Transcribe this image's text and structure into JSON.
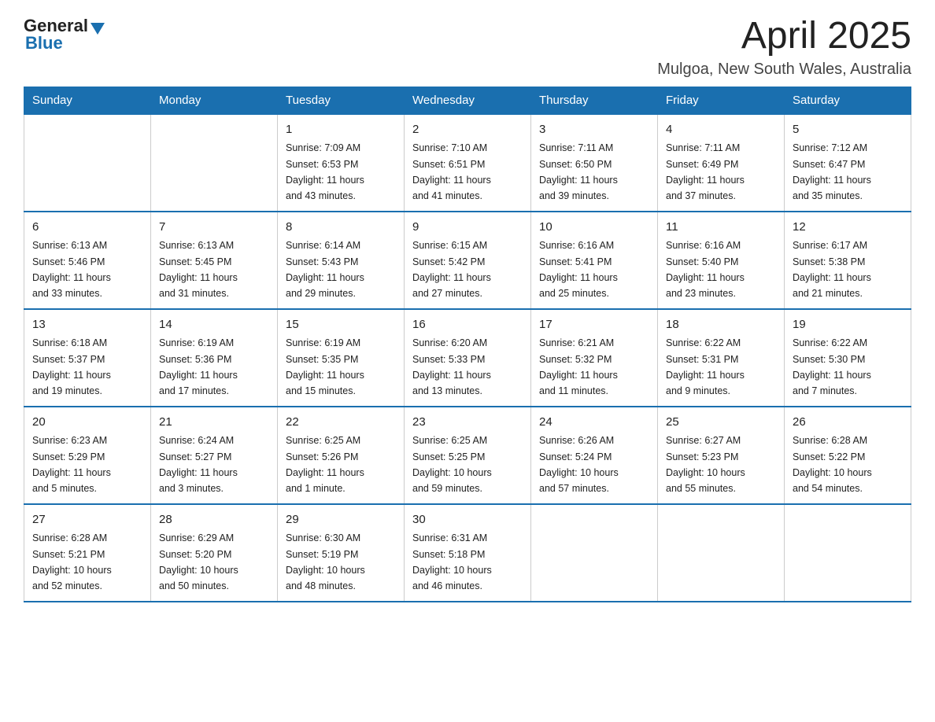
{
  "header": {
    "logo_general": "General",
    "logo_blue": "Blue",
    "month_title": "April 2025",
    "location": "Mulgoa, New South Wales, Australia"
  },
  "weekdays": [
    "Sunday",
    "Monday",
    "Tuesday",
    "Wednesday",
    "Thursday",
    "Friday",
    "Saturday"
  ],
  "weeks": [
    [
      {
        "day": "",
        "info": ""
      },
      {
        "day": "",
        "info": ""
      },
      {
        "day": "1",
        "info": "Sunrise: 7:09 AM\nSunset: 6:53 PM\nDaylight: 11 hours\nand 43 minutes."
      },
      {
        "day": "2",
        "info": "Sunrise: 7:10 AM\nSunset: 6:51 PM\nDaylight: 11 hours\nand 41 minutes."
      },
      {
        "day": "3",
        "info": "Sunrise: 7:11 AM\nSunset: 6:50 PM\nDaylight: 11 hours\nand 39 minutes."
      },
      {
        "day": "4",
        "info": "Sunrise: 7:11 AM\nSunset: 6:49 PM\nDaylight: 11 hours\nand 37 minutes."
      },
      {
        "day": "5",
        "info": "Sunrise: 7:12 AM\nSunset: 6:47 PM\nDaylight: 11 hours\nand 35 minutes."
      }
    ],
    [
      {
        "day": "6",
        "info": "Sunrise: 6:13 AM\nSunset: 5:46 PM\nDaylight: 11 hours\nand 33 minutes."
      },
      {
        "day": "7",
        "info": "Sunrise: 6:13 AM\nSunset: 5:45 PM\nDaylight: 11 hours\nand 31 minutes."
      },
      {
        "day": "8",
        "info": "Sunrise: 6:14 AM\nSunset: 5:43 PM\nDaylight: 11 hours\nand 29 minutes."
      },
      {
        "day": "9",
        "info": "Sunrise: 6:15 AM\nSunset: 5:42 PM\nDaylight: 11 hours\nand 27 minutes."
      },
      {
        "day": "10",
        "info": "Sunrise: 6:16 AM\nSunset: 5:41 PM\nDaylight: 11 hours\nand 25 minutes."
      },
      {
        "day": "11",
        "info": "Sunrise: 6:16 AM\nSunset: 5:40 PM\nDaylight: 11 hours\nand 23 minutes."
      },
      {
        "day": "12",
        "info": "Sunrise: 6:17 AM\nSunset: 5:38 PM\nDaylight: 11 hours\nand 21 minutes."
      }
    ],
    [
      {
        "day": "13",
        "info": "Sunrise: 6:18 AM\nSunset: 5:37 PM\nDaylight: 11 hours\nand 19 minutes."
      },
      {
        "day": "14",
        "info": "Sunrise: 6:19 AM\nSunset: 5:36 PM\nDaylight: 11 hours\nand 17 minutes."
      },
      {
        "day": "15",
        "info": "Sunrise: 6:19 AM\nSunset: 5:35 PM\nDaylight: 11 hours\nand 15 minutes."
      },
      {
        "day": "16",
        "info": "Sunrise: 6:20 AM\nSunset: 5:33 PM\nDaylight: 11 hours\nand 13 minutes."
      },
      {
        "day": "17",
        "info": "Sunrise: 6:21 AM\nSunset: 5:32 PM\nDaylight: 11 hours\nand 11 minutes."
      },
      {
        "day": "18",
        "info": "Sunrise: 6:22 AM\nSunset: 5:31 PM\nDaylight: 11 hours\nand 9 minutes."
      },
      {
        "day": "19",
        "info": "Sunrise: 6:22 AM\nSunset: 5:30 PM\nDaylight: 11 hours\nand 7 minutes."
      }
    ],
    [
      {
        "day": "20",
        "info": "Sunrise: 6:23 AM\nSunset: 5:29 PM\nDaylight: 11 hours\nand 5 minutes."
      },
      {
        "day": "21",
        "info": "Sunrise: 6:24 AM\nSunset: 5:27 PM\nDaylight: 11 hours\nand 3 minutes."
      },
      {
        "day": "22",
        "info": "Sunrise: 6:25 AM\nSunset: 5:26 PM\nDaylight: 11 hours\nand 1 minute."
      },
      {
        "day": "23",
        "info": "Sunrise: 6:25 AM\nSunset: 5:25 PM\nDaylight: 10 hours\nand 59 minutes."
      },
      {
        "day": "24",
        "info": "Sunrise: 6:26 AM\nSunset: 5:24 PM\nDaylight: 10 hours\nand 57 minutes."
      },
      {
        "day": "25",
        "info": "Sunrise: 6:27 AM\nSunset: 5:23 PM\nDaylight: 10 hours\nand 55 minutes."
      },
      {
        "day": "26",
        "info": "Sunrise: 6:28 AM\nSunset: 5:22 PM\nDaylight: 10 hours\nand 54 minutes."
      }
    ],
    [
      {
        "day": "27",
        "info": "Sunrise: 6:28 AM\nSunset: 5:21 PM\nDaylight: 10 hours\nand 52 minutes."
      },
      {
        "day": "28",
        "info": "Sunrise: 6:29 AM\nSunset: 5:20 PM\nDaylight: 10 hours\nand 50 minutes."
      },
      {
        "day": "29",
        "info": "Sunrise: 6:30 AM\nSunset: 5:19 PM\nDaylight: 10 hours\nand 48 minutes."
      },
      {
        "day": "30",
        "info": "Sunrise: 6:31 AM\nSunset: 5:18 PM\nDaylight: 10 hours\nand 46 minutes."
      },
      {
        "day": "",
        "info": ""
      },
      {
        "day": "",
        "info": ""
      },
      {
        "day": "",
        "info": ""
      }
    ]
  ]
}
